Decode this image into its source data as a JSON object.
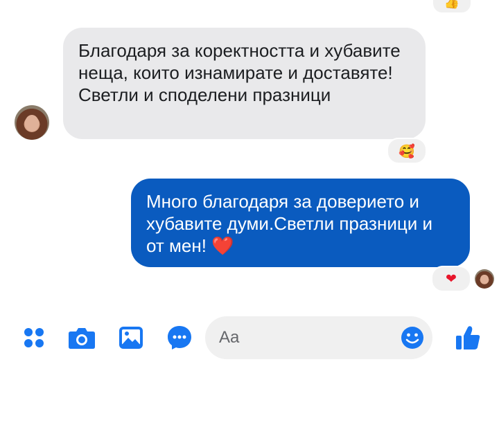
{
  "conversation": {
    "previous_reaction": "👍",
    "incoming": {
      "text": "Благодаря за коректността и хубавите неща, които изнамирате и доставяте! Светли  и споделени празници",
      "reaction": "🥰"
    },
    "outgoing": {
      "text": "Много благодаря за доверието и хубавите думи.Светли празници и от мен! ❤️",
      "reaction": "❤"
    }
  },
  "composer": {
    "placeholder": "Aa",
    "icons": [
      "apps-icon",
      "camera-icon",
      "gallery-icon",
      "chat-bubble-icon",
      "emoji-icon",
      "like-icon"
    ]
  },
  "colors": {
    "accent": "#1877f2",
    "outgoing_bubble": "#0a5bbf",
    "incoming_bubble": "#e9e9eb"
  }
}
